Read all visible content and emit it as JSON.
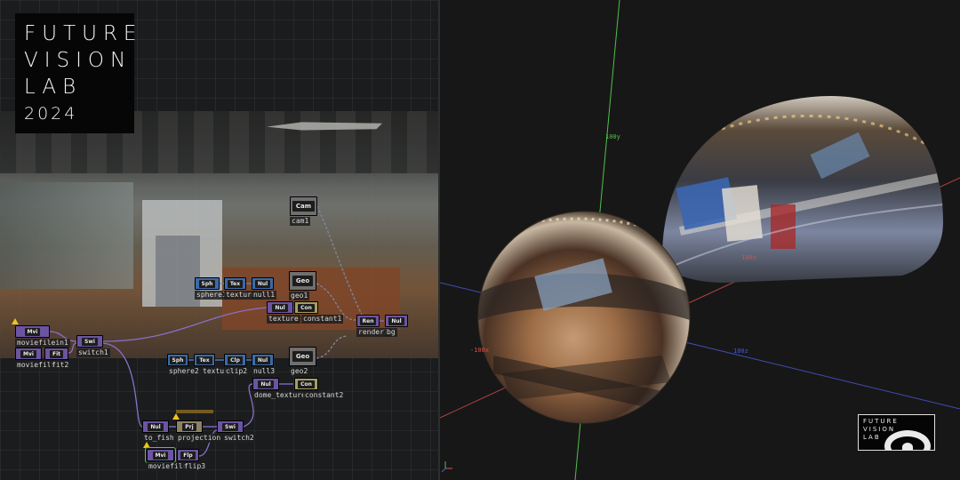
{
  "logo": {
    "lines": [
      "FUTURE",
      "VISION",
      "LAB",
      "2024"
    ],
    "small_lines": [
      "FUTURE",
      "VISION",
      "LAB"
    ]
  },
  "nodes": {
    "cam1": {
      "tag": "Cam",
      "label": "cam1"
    },
    "sphere1": {
      "tag": "Sph",
      "label": "sphere1"
    },
    "texture1": {
      "tag": "Tex",
      "label": "texture1"
    },
    "null1": {
      "tag": "Nul",
      "label": "null1"
    },
    "geo1": {
      "tag": "Geo",
      "label": "geo1"
    },
    "texture_null": {
      "tag": "Nul",
      "label": "texture"
    },
    "constant1": {
      "tag": "Con",
      "label": "constant1"
    },
    "render": {
      "tag": "Ren",
      "label": "render1"
    },
    "bg_null": {
      "tag": "Nul",
      "label": "bg"
    },
    "moviefilein1": {
      "tag": "Mvi",
      "label": "moviefilein1"
    },
    "moviefilein2": {
      "tag": "Mvi",
      "label": "moviefile"
    },
    "fit2": {
      "tag": "Fit",
      "label": "fit2"
    },
    "switch1": {
      "tag": "Swi",
      "label": "switch1"
    },
    "sphere2": {
      "tag": "Sph",
      "label": "sphere2"
    },
    "texture2": {
      "tag": "Tex",
      "label": "texture"
    },
    "clip2": {
      "tag": "Clp",
      "label": "clip2"
    },
    "null3": {
      "tag": "Nul",
      "label": "null3"
    },
    "geo2": {
      "tag": "Geo",
      "label": "geo2"
    },
    "dome_texture": {
      "tag": "Nul",
      "label": "dome_texture"
    },
    "constant2": {
      "tag": "Con",
      "label": "constant2"
    },
    "to_fish": {
      "tag": "Nul",
      "label": "to_fish"
    },
    "projection": {
      "tag": "Prj",
      "label": "projection"
    },
    "switch2": {
      "tag": "Swi",
      "label": "switch2"
    },
    "moviefilein3": {
      "tag": "Mvi",
      "label": "moviefile"
    },
    "flip": {
      "tag": "Flp",
      "label": "flip3"
    }
  },
  "viewport": {
    "axes": {
      "y_pos": "100y",
      "x_pos": "100x",
      "x_neg": "-100x",
      "z_pos": "100z"
    },
    "axis_colors": {
      "x": "#d8504a",
      "y": "#4fc24a",
      "z": "#4a5ad8"
    }
  }
}
